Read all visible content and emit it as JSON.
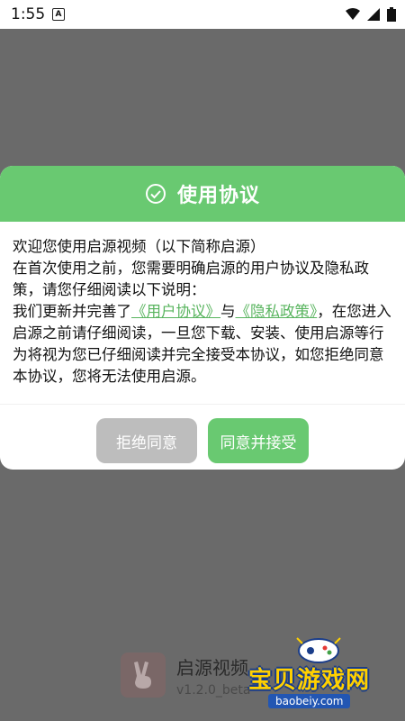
{
  "status_bar": {
    "time": "1:55",
    "notification_letter": "A"
  },
  "dialog": {
    "title": "使用协议",
    "line1": "欢迎您使用启源视频（以下简称启源）",
    "line2": "在首次使用之前，您需要明确启源的用户协议及隐私政策，请您仔细阅读以下说明：",
    "line3_prefix": "我们更新并完善了",
    "user_agreement_link": "《用户协议》",
    "line3_and": "与",
    "privacy_policy_link": "《隐私政策》",
    "line3_suffix": "，在您进入启源之前请仔细阅读，一旦您下载、安装、使用启源等行为将视为您已仔细阅读并完全接受本协议，如您拒绝同意本协议，您将无法使用启源。",
    "reject_button": "拒绝同意",
    "agree_button": "同意并接受"
  },
  "footer": {
    "app_name": "启源视频",
    "version": "v1.2.0_beta"
  },
  "watermark": {
    "title": "宝贝游戏网",
    "url": "baobeiy.com"
  },
  "colors": {
    "accent_green": "#69c971",
    "link_green": "#58b45e",
    "overlay_gray": "#6a6a6a",
    "reject_gray": "#bdbdbd"
  }
}
